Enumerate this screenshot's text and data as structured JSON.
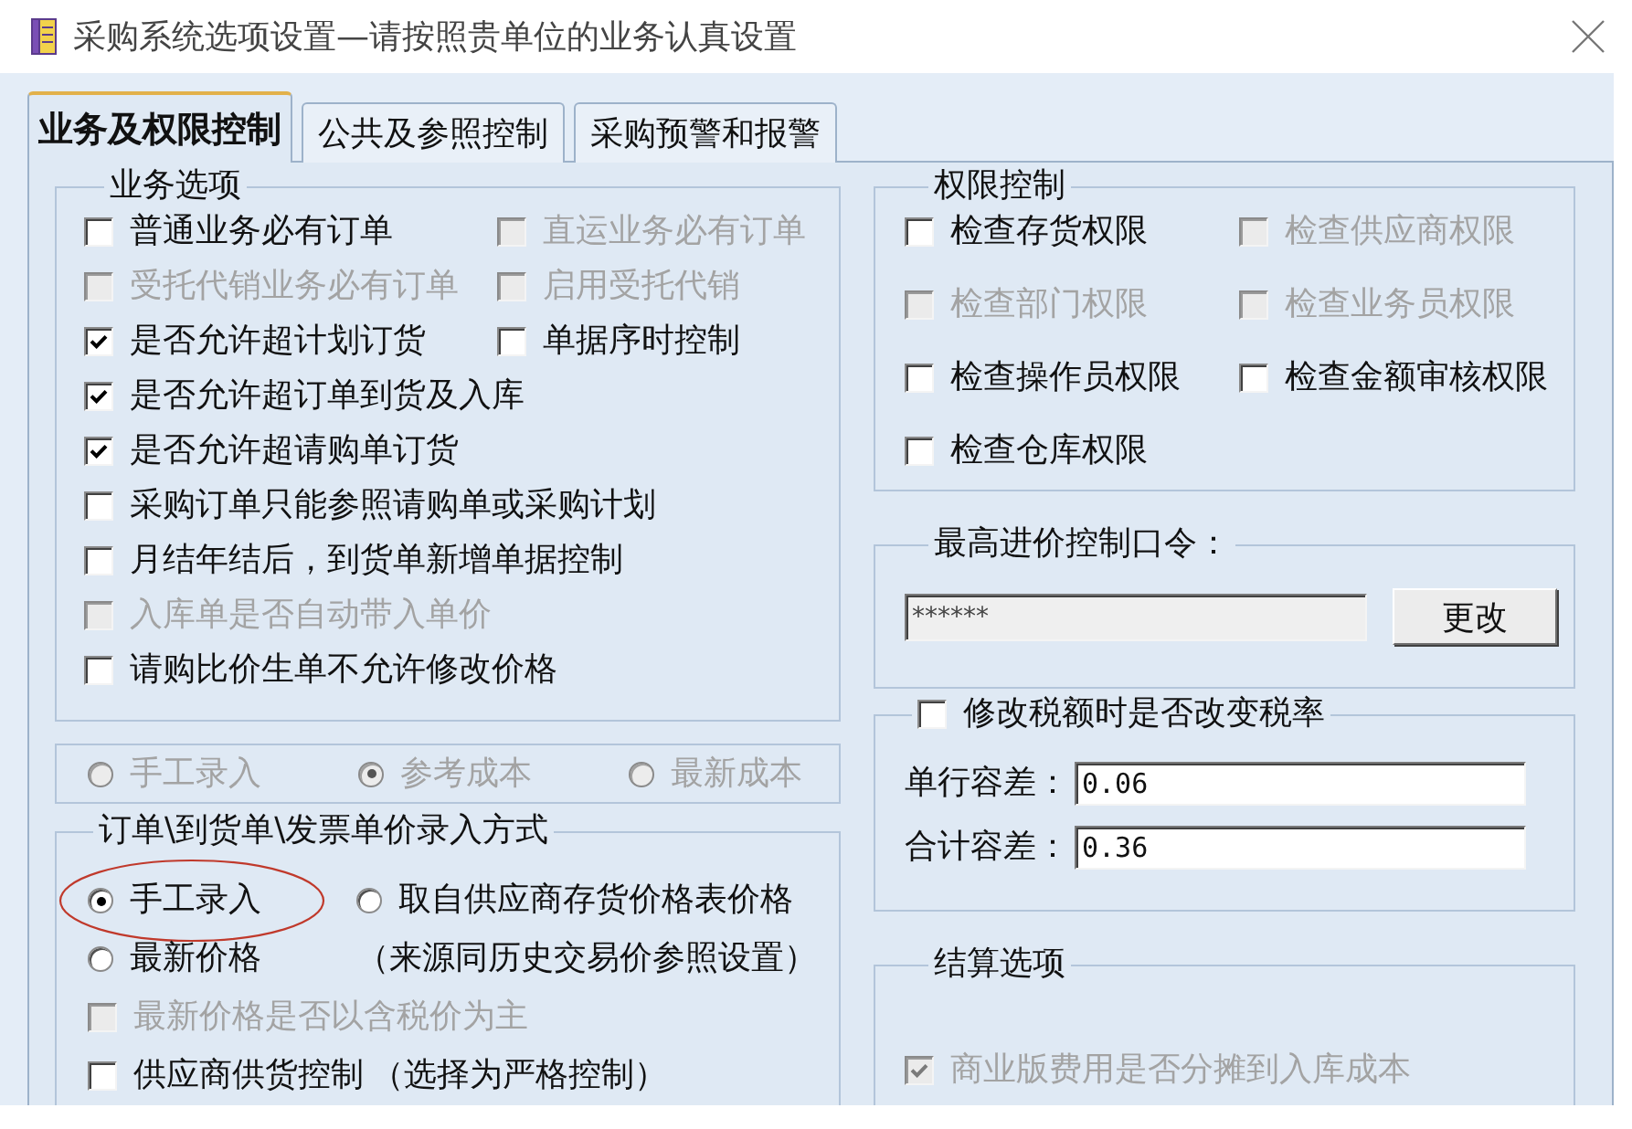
{
  "window": {
    "title": "采购系统选项设置—请按照贵单位的业务认真设置"
  },
  "tabs": [
    {
      "label": "业务及权限控制",
      "selected": true
    },
    {
      "label": "公共及参照控制",
      "selected": false
    },
    {
      "label": "采购预警和报警",
      "selected": false
    }
  ],
  "business_options": {
    "title": "业务选项",
    "rows": [
      [
        {
          "label": "普通业务必有订单",
          "checked": false,
          "disabled": false
        },
        {
          "label": "直运业务必有订单",
          "checked": false,
          "disabled": true
        }
      ],
      [
        {
          "label": "受托代销业务必有订单",
          "checked": false,
          "disabled": true
        },
        {
          "label": "启用受托代销",
          "checked": false,
          "disabled": true
        }
      ],
      [
        {
          "label": "是否允许超计划订货",
          "checked": true,
          "disabled": false
        },
        {
          "label": "单据序时控制",
          "checked": false,
          "disabled": false
        }
      ],
      [
        {
          "label": "是否允许超订单到货及入库",
          "checked": true,
          "disabled": false
        }
      ],
      [
        {
          "label": "是否允许超请购单订货",
          "checked": true,
          "disabled": false
        }
      ],
      [
        {
          "label": "采购订单只能参照请购单或采购计划",
          "checked": false,
          "disabled": false
        }
      ],
      [
        {
          "label": "月结年结后，到货单新增单据控制",
          "checked": false,
          "disabled": false
        }
      ],
      [
        {
          "label": "入库单是否自动带入单价",
          "checked": false,
          "disabled": true
        }
      ],
      [
        {
          "label": "请购比价生单不允许修改价格",
          "checked": false,
          "disabled": false
        }
      ]
    ]
  },
  "cost_source": {
    "options": [
      {
        "label": "手工录入",
        "selected": false,
        "disabled": true
      },
      {
        "label": "参考成本",
        "selected": true,
        "disabled": true
      },
      {
        "label": "最新成本",
        "selected": false,
        "disabled": true
      }
    ]
  },
  "price_entry": {
    "title": "订单\\到货单\\发票单价录入方式",
    "rows": [
      [
        {
          "kind": "radio",
          "label": "手工录入",
          "selected": true,
          "disabled": false,
          "highlighted": true
        },
        {
          "kind": "radio",
          "label": "取自供应商存货价格表价格",
          "selected": false,
          "disabled": false,
          "highlighted": false
        }
      ],
      [
        {
          "kind": "radio",
          "label": "最新价格",
          "selected": false,
          "disabled": false,
          "highlighted": false
        },
        {
          "kind": "note",
          "text": "（来源同历史交易价参照设置）"
        }
      ],
      [
        {
          "kind": "checkbox",
          "label": "最新价格是否以含税价为主",
          "checked": false,
          "disabled": true,
          "highlighted": false
        }
      ],
      [
        {
          "kind": "checkbox",
          "label": "供应商供货控制",
          "checked": false,
          "disabled": false,
          "highlighted": false
        },
        {
          "kind": "note",
          "text": "（选择为严格控制）"
        }
      ]
    ]
  },
  "permissions": {
    "title": "权限控制",
    "items": [
      {
        "label": "检查存货权限",
        "checked": false,
        "disabled": false
      },
      {
        "label": "检查供应商权限",
        "checked": false,
        "disabled": true
      },
      {
        "label": "检查部门权限",
        "checked": false,
        "disabled": true
      },
      {
        "label": "检查业务员权限",
        "checked": false,
        "disabled": true
      },
      {
        "label": "检查操作员权限",
        "checked": false,
        "disabled": false
      },
      {
        "label": "检查金额审核权限",
        "checked": false,
        "disabled": false
      },
      {
        "label": "检查仓库权限",
        "checked": false,
        "disabled": false
      }
    ]
  },
  "price_password": {
    "title": "最高进价控制口令：",
    "value": "******",
    "button": "更改"
  },
  "tax": {
    "toggle": {
      "label": "修改税额时是否改变税率",
      "checked": false,
      "disabled": false
    },
    "fields": [
      {
        "label": "单行容差：",
        "value": "0.06"
      },
      {
        "label": "合计容差：",
        "value": "0.36"
      }
    ]
  },
  "settlement": {
    "title": "结算选项",
    "items": [
      {
        "label": "商业版费用是否分摊到入库成本",
        "checked": true,
        "disabled": true
      }
    ]
  }
}
